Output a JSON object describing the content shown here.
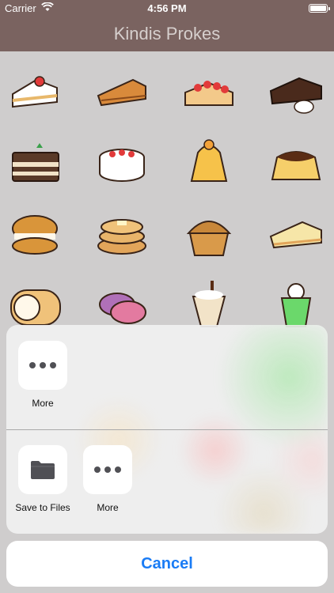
{
  "status_bar": {
    "carrier": "Carrier",
    "time": "4:56 PM"
  },
  "nav": {
    "title": "Kindis Prokes"
  },
  "stickers": [
    "strawberry-shortcake-icon",
    "apple-pie-icon",
    "strawberry-tart-icon",
    "chocolate-cake-icon",
    "tiramisu-icon",
    "fruit-cake-icon",
    "mont-blanc-icon",
    "pudding-icon",
    "cream-puff-icon",
    "pancakes-icon",
    "muffin-icon",
    "cheesecake-icon",
    "roll-cake-icon",
    "macarons-icon",
    "parfait-icon",
    "cream-soda-icon"
  ],
  "share_sheet": {
    "row1": [
      {
        "label": "More",
        "icon": "more-icon"
      }
    ],
    "row2": [
      {
        "label": "Save to Files",
        "icon": "folder-icon"
      },
      {
        "label": "More",
        "icon": "more-icon"
      }
    ],
    "cancel_label": "Cancel"
  },
  "colors": {
    "nav_bar": "#7a6360",
    "accent": "#1a7cf5"
  }
}
